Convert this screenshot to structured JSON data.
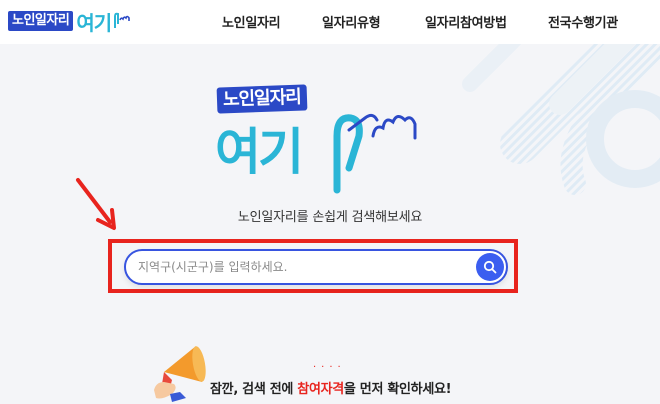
{
  "header": {
    "logo_badge": "노인일자리",
    "logo_big": "여기",
    "nav": [
      "노인일자리",
      "일자리유형",
      "일자리참여방법",
      "전국수행기관"
    ]
  },
  "hero": {
    "logo_badge": "노인일자리",
    "logo_big": "여기",
    "subtitle": "노인일자리를 손쉽게 검색해보세요",
    "search": {
      "placeholder": "지역구(시군구)를 입력하세요.",
      "value": ""
    },
    "notice": {
      "before": "잠깐, 검색 전에 ",
      "emphasis": "참여자격",
      "after": "을 먼저 확인하세요!"
    }
  },
  "colors": {
    "brand_blue": "#2b49c6",
    "brand_cyan": "#2ab5d6",
    "highlight_red": "#e8241e",
    "search_blue": "#3b5ef0"
  },
  "icons": [
    "search-icon",
    "megaphone-icon",
    "pointer-arrow-icon",
    "hand-logo-icon"
  ]
}
